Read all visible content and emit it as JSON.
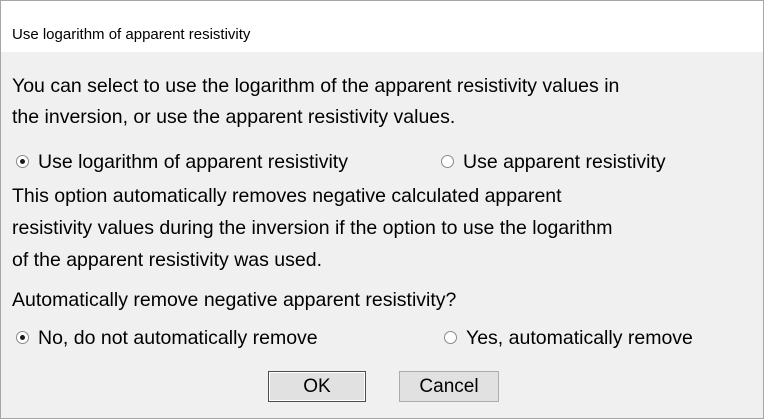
{
  "window": {
    "title": "Use logarithm of apparent resistivity"
  },
  "intro": {
    "line1": "You can select to use the logarithm of the apparent resistivity values in",
    "line2": "the inversion, or use the apparent resistivity values."
  },
  "resistivity_mode": {
    "options": [
      {
        "label": "Use logarithm of apparent resistivity",
        "checked": true
      },
      {
        "label": "Use apparent resistivity",
        "checked": false
      }
    ]
  },
  "note": {
    "line1": "This option automatically removes negative calculated apparent",
    "line2": "resistivity values during the inversion if the option to use the logarithm",
    "line3": "of the apparent resistivity was used."
  },
  "question": "Automatically remove negative apparent resistivity?",
  "remove_negative": {
    "options": [
      {
        "label": "No, do not automatically remove",
        "checked": true
      },
      {
        "label": "Yes, automatically remove",
        "checked": false
      }
    ]
  },
  "buttons": {
    "ok_label": "OK",
    "cancel_label": "Cancel"
  }
}
